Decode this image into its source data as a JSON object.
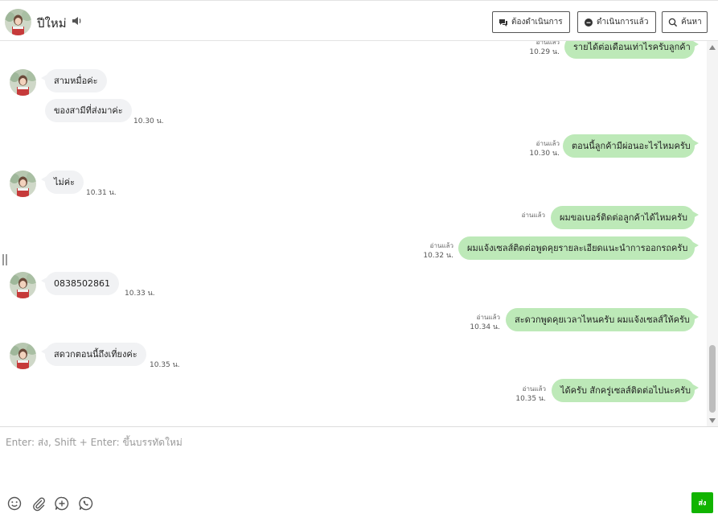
{
  "header": {
    "contact_name": "ปีใหม่",
    "buttons": {
      "todo": "ต้องดำเนินการ",
      "done": "ดำเนินการแล้ว",
      "search": "ค้นหา"
    }
  },
  "messages": [
    {
      "direction": "out",
      "text": "รายได้ต่อเดือนเท่าไรครับลูกค้า",
      "read": "อ่านแล้ว",
      "time": "10.29 น."
    },
    {
      "direction": "in",
      "text": "สามหมื่อค่ะ",
      "time": ""
    },
    {
      "direction": "in",
      "text": "ของสามีที่ส่งมาค่ะ",
      "time": "10.30 น."
    },
    {
      "direction": "out",
      "text": "ตอนนี้ลูกค้ามีผ่อนอะไรไหมครับ",
      "read": "อ่านแล้ว",
      "time": "10.30 น."
    },
    {
      "direction": "in",
      "text": "ไม่ค่ะ",
      "time": "10.31 น."
    },
    {
      "direction": "out",
      "text": "ผมขอเบอร์ติดต่อลูกค้าได้ไหมครับ",
      "read": "อ่านแล้ว",
      "time": ""
    },
    {
      "direction": "out",
      "text": "ผมแจ้งเซลส์ติดต่อพูดคุยรายละเอียดแนะนำการออกรถครับ",
      "read": "อ่านแล้ว",
      "time": "10.32 น."
    },
    {
      "direction": "in",
      "text": "0838502861",
      "time": "10.33 น."
    },
    {
      "direction": "out",
      "text": "สะดวกพูดคุยเวลาไหนครับ ผมแจ้งเซลส์ให้ครับ",
      "read": "อ่านแล้ว",
      "time": "10.34 น."
    },
    {
      "direction": "in",
      "text": "สดวกตอนนี้ถึงเที่ยงค่ะ",
      "time": "10.35 น."
    },
    {
      "direction": "out",
      "text": "ได้ครับ สักครู่เซลส์ติดต่อไปนะครับ",
      "read": "อ่านแล้ว",
      "time": "10.35 น."
    }
  ],
  "composer": {
    "placeholder": "Enter: ส่ง, Shift + Enter: ขึ้นบรรทัดใหม่",
    "send_label": "ส่ง"
  },
  "icons": [
    "emoji-icon",
    "attachment-icon",
    "add-icon",
    "phone-icon"
  ],
  "colors": {
    "outgoing_bubble": "#bde9b8",
    "incoming_bubble": "#f1f2f4",
    "send_button": "#11b400"
  }
}
